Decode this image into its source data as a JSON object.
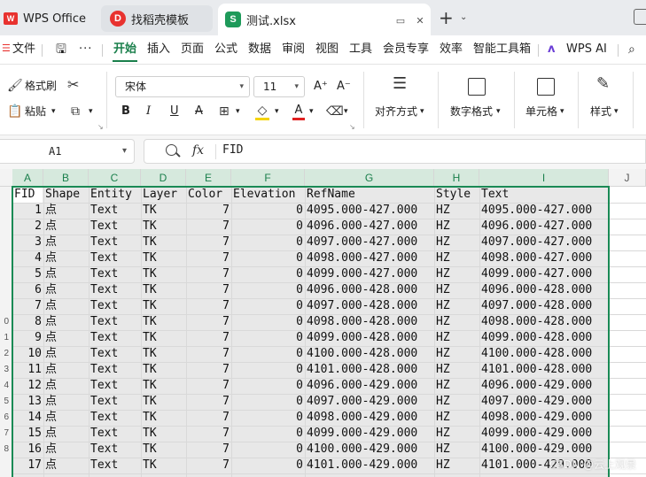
{
  "tabs": [
    {
      "label": "WPS Office",
      "logo": "W"
    },
    {
      "label": "找稻壳模板",
      "logo": "D"
    },
    {
      "label": "测试.xlsx",
      "logo": "S"
    }
  ],
  "menu": {
    "file": "文件",
    "items": [
      "开始",
      "插入",
      "页面",
      "公式",
      "数据",
      "审阅",
      "视图",
      "工具",
      "会员专享",
      "效率",
      "智能工具箱"
    ],
    "wps_ai": "WPS AI"
  },
  "ribbon": {
    "format_painter": "格式刷",
    "paste": "粘贴",
    "font_name": "宋体",
    "font_size": "11",
    "bold": "B",
    "italic": "I",
    "underline": "U",
    "strike": "A",
    "font_color_letter": "A",
    "grow_font": "A⁺",
    "shrink_font": "A⁻",
    "align": "对齐方式",
    "number_format": "数字格式",
    "cell": "单元格",
    "style": "样式"
  },
  "formula_bar": {
    "name_box": "A1",
    "fx": "fx",
    "content": "FID"
  },
  "columns": [
    "A",
    "B",
    "C",
    "D",
    "E",
    "F",
    "G",
    "H",
    "I",
    "J"
  ],
  "row_numbers": [
    "",
    "",
    "",
    "",
    "",
    "",
    "",
    "",
    "0",
    "1",
    "2",
    "3",
    "4",
    "5",
    "6",
    "7",
    "8"
  ],
  "table": {
    "headers": [
      "FID",
      "Shape",
      "Entity",
      "Layer",
      "Color",
      "Elevation",
      "RefName",
      "Style",
      "Text"
    ],
    "rows": [
      [
        "1",
        "点",
        "Text",
        "TK",
        "7",
        "0",
        "4095.000-427.000",
        "HZ",
        "4095.000-427.000"
      ],
      [
        "2",
        "点",
        "Text",
        "TK",
        "7",
        "0",
        "4096.000-427.000",
        "HZ",
        "4096.000-427.000"
      ],
      [
        "3",
        "点",
        "Text",
        "TK",
        "7",
        "0",
        "4097.000-427.000",
        "HZ",
        "4097.000-427.000"
      ],
      [
        "4",
        "点",
        "Text",
        "TK",
        "7",
        "0",
        "4098.000-427.000",
        "HZ",
        "4098.000-427.000"
      ],
      [
        "5",
        "点",
        "Text",
        "TK",
        "7",
        "0",
        "4099.000-427.000",
        "HZ",
        "4099.000-427.000"
      ],
      [
        "6",
        "点",
        "Text",
        "TK",
        "7",
        "0",
        "4096.000-428.000",
        "HZ",
        "4096.000-428.000"
      ],
      [
        "7",
        "点",
        "Text",
        "TK",
        "7",
        "0",
        "4097.000-428.000",
        "HZ",
        "4097.000-428.000"
      ],
      [
        "8",
        "点",
        "Text",
        "TK",
        "7",
        "0",
        "4098.000-428.000",
        "HZ",
        "4098.000-428.000"
      ],
      [
        "9",
        "点",
        "Text",
        "TK",
        "7",
        "0",
        "4099.000-428.000",
        "HZ",
        "4099.000-428.000"
      ],
      [
        "10",
        "点",
        "Text",
        "TK",
        "7",
        "0",
        "4100.000-428.000",
        "HZ",
        "4100.000-428.000"
      ],
      [
        "11",
        "点",
        "Text",
        "TK",
        "7",
        "0",
        "4101.000-428.000",
        "HZ",
        "4101.000-428.000"
      ],
      [
        "12",
        "点",
        "Text",
        "TK",
        "7",
        "0",
        "4096.000-429.000",
        "HZ",
        "4096.000-429.000"
      ],
      [
        "13",
        "点",
        "Text",
        "TK",
        "7",
        "0",
        "4097.000-429.000",
        "HZ",
        "4097.000-429.000"
      ],
      [
        "14",
        "点",
        "Text",
        "TK",
        "7",
        "0",
        "4098.000-429.000",
        "HZ",
        "4098.000-429.000"
      ],
      [
        "15",
        "点",
        "Text",
        "TK",
        "7",
        "0",
        "4099.000-429.000",
        "HZ",
        "4099.000-429.000"
      ],
      [
        "16",
        "点",
        "Text",
        "TK",
        "7",
        "0",
        "4100.000-429.000",
        "HZ",
        "4100.000-429.000"
      ],
      [
        "17",
        "点",
        "Text",
        "TK",
        "7",
        "0",
        "4101.000-429.000",
        "HZ",
        "4101.000-429.000"
      ]
    ]
  },
  "watermark": "CSDN @云上观景",
  "colors": {
    "accent": "#1a7f4b",
    "selection_border": "#1a8a55",
    "selection_fill": "#e8e8e8",
    "header_selected": "#d6e9dd",
    "wps_red": "#e8322f",
    "xlsx_green": "#1e9a5a"
  }
}
